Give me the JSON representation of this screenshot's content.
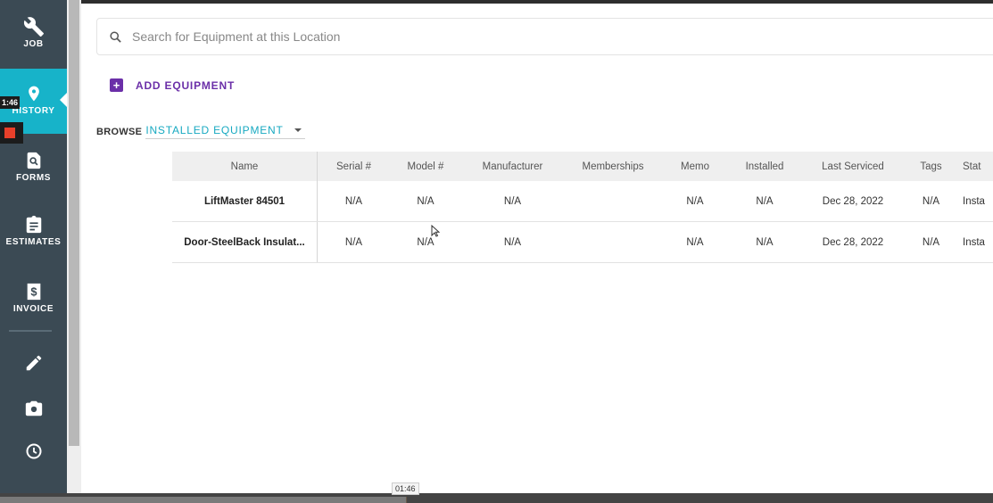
{
  "sidebar": {
    "items": [
      {
        "label": "JOB",
        "icon": "wrench-icon"
      },
      {
        "label": "HISTORY",
        "icon": "map-pin-icon"
      },
      {
        "label": "FORMS",
        "icon": "form-search-icon"
      },
      {
        "label": "ESTIMATES",
        "icon": "clipboard-icon"
      },
      {
        "label": "INVOICE",
        "icon": "invoice-dollar-icon"
      }
    ],
    "tools": [
      "pencil-icon",
      "camera-icon",
      "clock-icon"
    ],
    "accent": "#17b3c9",
    "background": "#3b4a54"
  },
  "recorder": {
    "timer": "1:46"
  },
  "search": {
    "placeholder": "Search for Equipment at this Location"
  },
  "add_equipment": {
    "label": "ADD EQUIPMENT",
    "color": "#6b2fa8"
  },
  "browse": {
    "label": "BROWSE",
    "selected": "INSTALLED EQUIPMENT"
  },
  "table": {
    "columns": [
      "Name",
      "Serial #",
      "Model #",
      "Manufacturer",
      "Memberships",
      "Memo",
      "Installed",
      "Last Serviced",
      "Tags",
      "Stat"
    ],
    "rows": [
      [
        "LiftMaster 84501",
        "N/A",
        "N/A",
        "N/A",
        "",
        "N/A",
        "N/A",
        "Dec 28, 2022",
        "N/A",
        "Insta"
      ],
      [
        "Door-SteelBack Insulat...",
        "N/A",
        "N/A",
        "N/A",
        "",
        "N/A",
        "N/A",
        "Dec 28, 2022",
        "N/A",
        "Insta"
      ]
    ]
  },
  "video": {
    "timestamp": "01:46"
  }
}
